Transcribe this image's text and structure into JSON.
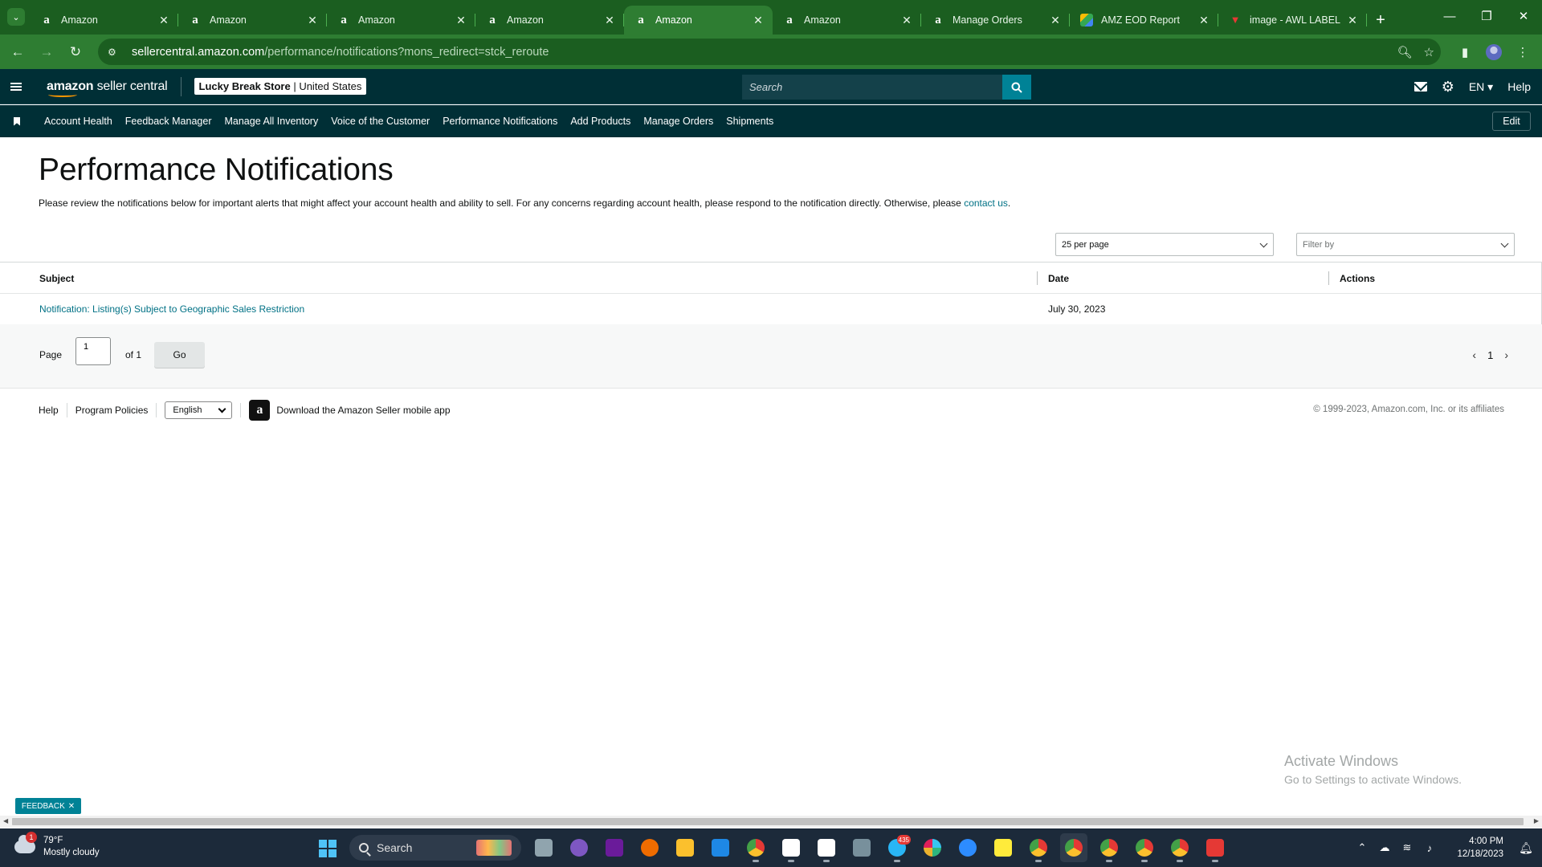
{
  "browser": {
    "tabs": [
      {
        "title": "Amazon",
        "favicon": "amazon-favicon",
        "active": false
      },
      {
        "title": "Amazon",
        "favicon": "amazon-favicon",
        "active": false
      },
      {
        "title": "Amazon",
        "favicon": "amazon-favicon",
        "active": false
      },
      {
        "title": "Amazon",
        "favicon": "amazon-favicon",
        "active": false
      },
      {
        "title": "Amazon",
        "favicon": "amazon-favicon",
        "active": true
      },
      {
        "title": "Amazon",
        "favicon": "amazon-favicon",
        "active": false
      },
      {
        "title": "Manage Orders",
        "favicon": "amazon-favicon",
        "active": false
      },
      {
        "title": "AMZ EOD Report",
        "favicon": "sheets-favicon",
        "active": false
      },
      {
        "title": "image - AWL LABEL",
        "favicon": "label-favicon",
        "active": false
      }
    ],
    "url_host": "sellercentral.amazon.com",
    "url_path": "/performance/notifications?mons_redirect=stck_reroute"
  },
  "header": {
    "logo_bold": "amazon",
    "logo_rest": " seller central",
    "store_name": "Lucky Break Store",
    "store_sep": " | ",
    "marketplace": "United States",
    "search_placeholder": "Search",
    "language": "EN",
    "help": "Help"
  },
  "nav": {
    "links": [
      "Account Health",
      "Feedback Manager",
      "Manage All Inventory",
      "Voice of the Customer",
      "Performance Notifications",
      "Add Products",
      "Manage Orders",
      "Shipments"
    ],
    "edit": "Edit"
  },
  "page": {
    "title": "Performance Notifications",
    "description": "Please review the notifications below for important alerts that might affect your account health and ability to sell. For any concerns regarding account health, please respond to the notification directly. Otherwise, please ",
    "contact_link": "contact us",
    "description_end": ".",
    "per_page": "25 per page",
    "filter_placeholder": "Filter by"
  },
  "table": {
    "columns": {
      "subject": "Subject",
      "date": "Date",
      "actions": "Actions"
    },
    "rows": [
      {
        "subject": "Notification: Listing(s) Subject to Geographic Sales Restriction",
        "date": "July 30, 2023",
        "actions": ""
      }
    ]
  },
  "pager": {
    "page_label": "Page",
    "current": "1",
    "of_label": "of 1",
    "go": "Go",
    "page_number": "1"
  },
  "footer": {
    "help": "Help",
    "policies": "Program Policies",
    "language": "English",
    "app_download": "Download the Amazon Seller mobile app",
    "copyright": "© 1999-2023, Amazon.com, Inc. or its affiliates"
  },
  "watermark": {
    "line1": "Activate Windows",
    "line2": "Go to Settings to activate Windows."
  },
  "feedback": "FEEDBACK",
  "taskbar": {
    "weather_temp": "79°F",
    "weather_desc": "Mostly cloudy",
    "weather_badge": "1",
    "search": "Search",
    "time": "4:00 PM",
    "date": "12/18/2023",
    "telegram_badge": "435"
  },
  "colors": {
    "browser_frame": "#1b5e20",
    "seller_header": "#002f36",
    "link": "#007185",
    "accent": "#008296"
  }
}
